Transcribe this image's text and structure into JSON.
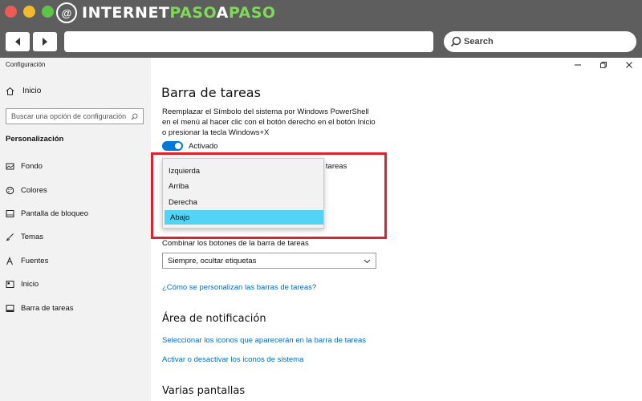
{
  "browser": {
    "brand_mark": "@",
    "brand_part1": "INTERNET",
    "brand_part2": "PASO",
    "brand_part3": "A",
    "brand_part4": "PASO",
    "search_label": "Search",
    "accent_color": "#7ed957"
  },
  "window": {
    "title": "Configuración"
  },
  "sidebar": {
    "home_label": "Inicio",
    "search_placeholder": "Buscar una opción de configuración",
    "section_label": "Personalización",
    "items": [
      {
        "label": "Fondo",
        "icon": "image-icon"
      },
      {
        "label": "Colores",
        "icon": "palette-icon"
      },
      {
        "label": "Pantalla de bloqueo",
        "icon": "lock-screen-icon"
      },
      {
        "label": "Temas",
        "icon": "brush-icon"
      },
      {
        "label": "Fuentes",
        "icon": "font-icon"
      },
      {
        "label": "Inicio",
        "icon": "start-icon"
      },
      {
        "label": "Barra de tareas",
        "icon": "taskbar-icon"
      }
    ]
  },
  "main": {
    "title": "Barra de tareas",
    "description": "Reemplazar el Símbolo del sistema por Windows PowerShell en el menú al hacer clic con el botón derecho en el botón Inicio o presionar la tecla Windows+X",
    "toggle_label": "Activado",
    "partial_label": "e tareas",
    "dropdown_options": [
      "Izquierda",
      "Arriba",
      "Derecha",
      "Abajo"
    ],
    "selected_option": "Abajo",
    "combine_label": "Combinar los botones de la barra de tareas",
    "combine_value": "Siempre, ocultar etiquetas",
    "help_link": "¿Cómo se personalizan las barras de tareas?",
    "notification_heading": "Área de notificación",
    "notification_link1": "Seleccionar los iconos que aparecerán en la barra de tareas",
    "notification_link2": "Activar o desactivar los iconos de sistema",
    "multi_display_heading": "Varias pantallas"
  },
  "colors": {
    "toggle_on": "#0078d7",
    "selected_option": "#54d4f4",
    "highlight_border": "#e0202a",
    "link": "#0a6bb5"
  }
}
